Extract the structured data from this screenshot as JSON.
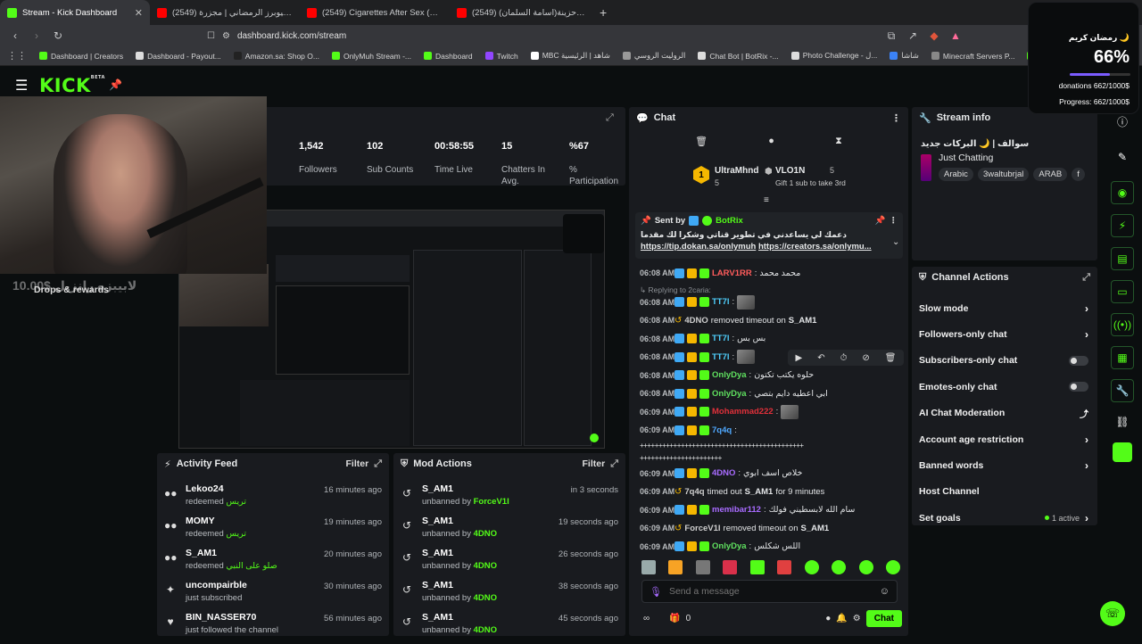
{
  "browser": {
    "tabs": [
      {
        "title": "Stream - Kick Dashboard",
        "active": true,
        "color": "#53fc18"
      },
      {
        "title": "(2549) تحدي اليوتيوبرز الرمضاني | مجزرة",
        "active": false,
        "color": "#ff0000"
      },
      {
        "title": "(2549) Cigarettes After Sex (Full Albu",
        "active": false,
        "color": "#ff0000"
      },
      {
        "title": "(2549) آهات حزينة(اسامة السلمان) - be",
        "active": false,
        "color": "#ff0000"
      }
    ],
    "url": "dashboard.kick.com/stream",
    "bookmarks": [
      {
        "label": "Dashboard | Creators",
        "color": "#53fc18"
      },
      {
        "label": "Dashboard - Payout...",
        "color": "#dddddd"
      },
      {
        "label": "Amazon.sa: Shop O...",
        "color": "#222222"
      },
      {
        "label": "OnlyMuh Stream -...",
        "color": "#53fc18"
      },
      {
        "label": "Dashboard",
        "color": "#53fc18"
      },
      {
        "label": "Twitch",
        "color": "#9146ff"
      },
      {
        "label": "MBC شاهد | الرئيسية",
        "color": "#ffffff"
      },
      {
        "label": "الروليت الروسي",
        "color": "#999999"
      },
      {
        "label": "Chat Bot | BotRix -...",
        "color": "#dddddd"
      },
      {
        "label": "Photo Challenge - ل...",
        "color": "#dddddd"
      },
      {
        "label": "شاشا",
        "color": "#3b82f6"
      },
      {
        "label": "Minecraft Servers P...",
        "color": "#888888"
      },
      {
        "label": "MineCraft | Serv",
        "color": "#53fc18"
      }
    ]
  },
  "kick": {
    "logo": "KICK",
    "logo_sup": "BETA"
  },
  "stats": [
    {
      "value": "1,542",
      "label": "Followers"
    },
    {
      "value": "102",
      "label": "Sub Counts"
    },
    {
      "value": "00:58:55",
      "label": "Time Live"
    },
    {
      "value": "15",
      "label": "Chatters In Avg."
    },
    {
      "value": "%67",
      "label": "% Participation"
    }
  ],
  "webcam_overlay": {
    "ghost_text": "10.00$ لابيبزه رانزيل",
    "drops": "Drops & rewards"
  },
  "activity_feed": {
    "title": "Activity Feed",
    "filter": "Filter",
    "items": [
      {
        "icon": "user-icon",
        "name": "Lekoo24",
        "action": "redeemed",
        "reward": "تريس",
        "time": "16 minutes ago"
      },
      {
        "icon": "user-icon",
        "name": "MOMY",
        "action": "redeemed",
        "reward": "تريس",
        "time": "19 minutes ago"
      },
      {
        "icon": "user-icon",
        "name": "S_AM1",
        "action": "redeemed",
        "reward": "صلو على النبي",
        "time": "20 minutes ago"
      },
      {
        "icon": "star-icon",
        "name": "uncompairble",
        "action": "just subscribed",
        "reward": "",
        "time": "30 minutes ago"
      },
      {
        "icon": "heart-icon",
        "name": "BIN_NASSER70",
        "action": "just followed the channel",
        "reward": "",
        "time": "56 minutes ago"
      }
    ]
  },
  "mod_actions": {
    "title": "Mod Actions",
    "filter": "Filter",
    "items": [
      {
        "name": "S_AM1",
        "action": "unbanned by",
        "by": "ForceV1I",
        "time": "in 3 seconds"
      },
      {
        "name": "S_AM1",
        "action": "unbanned by",
        "by": "4DNO",
        "time": "19 seconds ago"
      },
      {
        "name": "S_AM1",
        "action": "unbanned by",
        "by": "4DNO",
        "time": "26 seconds ago"
      },
      {
        "name": "S_AM1",
        "action": "unbanned by",
        "by": "4DNO",
        "time": "38 seconds ago"
      },
      {
        "name": "S_AM1",
        "action": "unbanned by",
        "by": "4DNO",
        "time": "45 seconds ago"
      }
    ]
  },
  "chat": {
    "title": "Chat",
    "top_gifters": [
      {
        "name": "UltraMhnd",
        "count": "5"
      },
      {
        "name": "VLO1N",
        "count": "5",
        "note": "Gift 1 sub to take 3rd"
      }
    ],
    "pinned": {
      "sent_by": "Sent by",
      "bot": "BotRix",
      "text": "دعمك لي يساعدني في تطوير قناتي وشكرا لك مقدما",
      "link1": "https://tip.dokan.sa/onlymuh",
      "link2": "https://creators.sa/onlymu..."
    },
    "reply_note": "Replying to 2caria: ",
    "messages": [
      {
        "time": "06:08 AM",
        "user": "LARV1RR",
        "color": "#ff5c5c",
        "text": "محمد محمد",
        "emote": false,
        "type": "msg"
      },
      {
        "time": "06:08 AM",
        "user": "TT7l",
        "color": "#4fd1ff",
        "text": "",
        "emote": true,
        "type": "msg"
      },
      {
        "time": "06:08 AM",
        "user": "4DNO",
        "color": "#cfcfcf",
        "text": "removed timeout on",
        "target": "S_AM1",
        "emote": false,
        "type": "mod"
      },
      {
        "time": "06:08 AM",
        "user": "TT7l",
        "color": "#4fd1ff",
        "text": "بس بس",
        "emote": false,
        "type": "msg"
      },
      {
        "time": "06:08 AM",
        "user": "TT7l",
        "color": "#4fd1ff",
        "text": "",
        "emote": true,
        "type": "msg"
      },
      {
        "time": "06:08 AM",
        "user": "OnlyDya",
        "color": "#5fe05f",
        "text": "حلوه يكتب تكتون",
        "emote": false,
        "type": "msg"
      },
      {
        "time": "06:08 AM",
        "user": "OnlyDya",
        "color": "#5fe05f",
        "text": "ابي اعطيه دايم بتصي",
        "emote": false,
        "type": "msg"
      },
      {
        "time": "06:09 AM",
        "user": "Mohammad222",
        "color": "#e0303a",
        "text": "",
        "emote": true,
        "type": "msg"
      },
      {
        "time": "06:09 AM",
        "user": "7q4q",
        "color": "#4fa8ff",
        "text": "",
        "emote": false,
        "type": "msg"
      },
      {
        "time": "",
        "user": "",
        "color": "#ffffff",
        "text": "++++++++++++++++++++++++++++++++++++++++++++",
        "emote": false,
        "type": "cont"
      },
      {
        "time": "",
        "user": "",
        "color": "#ffffff",
        "text": "++++++++++++++++++++++",
        "emote": false,
        "type": "cont"
      },
      {
        "time": "06:09 AM",
        "user": "4DNO",
        "color": "#a86bff",
        "text": "خلاص اسف ابوي",
        "emote": false,
        "type": "msg"
      },
      {
        "time": "06:09 AM",
        "user": "7q4q",
        "color": "#cfcfcf",
        "text": "timed out",
        "target": "S_AM1",
        "suffix": "for 9 minutes",
        "emote": false,
        "type": "mod"
      },
      {
        "time": "06:09 AM",
        "user": "memibar112",
        "color": "#a86bff",
        "text": "سام الله لابسطيني فولك",
        "emote": false,
        "type": "msg"
      },
      {
        "time": "06:09 AM",
        "user": "ForceV1I",
        "color": "#cfcfcf",
        "text": "removed timeout on",
        "target": "S_AM1",
        "emote": false,
        "type": "mod"
      },
      {
        "time": "06:09 AM",
        "user": "OnlyDya",
        "color": "#5fe05f",
        "text": "اللس شكلس",
        "emote": false,
        "type": "msg"
      }
    ],
    "input_placeholder": "Send a message",
    "points": "0",
    "send_label": "Chat"
  },
  "stream_info": {
    "title": "Stream info",
    "stream_title": "سوالف | 🌙 البركات جديد",
    "category": "Just Chatting",
    "tags": [
      "Arabic",
      "3waltubrjal",
      "ARAB",
      "f"
    ]
  },
  "channel_actions": {
    "title": "Channel Actions",
    "items": [
      {
        "label": "Slow mode",
        "control": "chevron"
      },
      {
        "label": "Followers-only chat",
        "control": "chevron"
      },
      {
        "label": "Subscribers-only chat",
        "control": "toggle"
      },
      {
        "label": "Emotes-only chat",
        "control": "toggle"
      },
      {
        "label": "AI Chat Moderation",
        "control": "external"
      },
      {
        "label": "Account age restriction",
        "control": "chevron"
      },
      {
        "label": "Banned words",
        "control": "chevron"
      },
      {
        "label": "Host Channel",
        "control": "none"
      },
      {
        "label": "Set goals",
        "control": "chevron",
        "status": "1 active"
      }
    ]
  },
  "donation_overlay": {
    "title": "رمضان كريم 🌙",
    "percent": "66%",
    "progress": 0.66,
    "donations": "donations 662/1000$",
    "progress_text": "Progress: 662/1000$"
  },
  "colors": {
    "accent": "#53fc18",
    "panel": "#191b1f",
    "bg": "#0b0e0f"
  }
}
